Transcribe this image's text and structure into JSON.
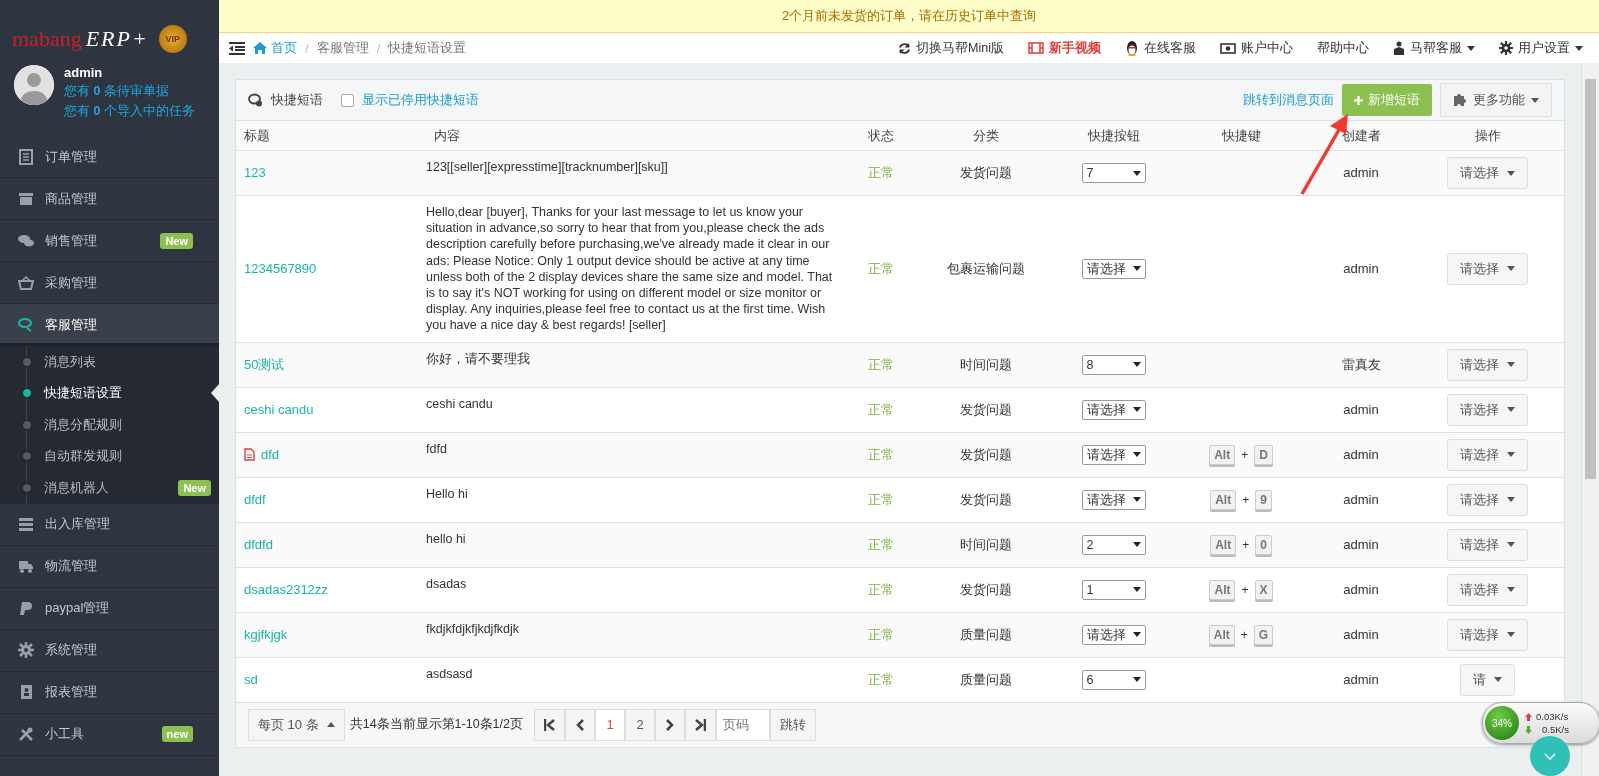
{
  "sidebar": {
    "logo": {
      "brand": "mabang",
      "product": "ERP+",
      "badge": "VIP"
    },
    "user": {
      "name": "admin",
      "lines": [
        "您有 **0** 条待审单据",
        "您有 **0** 个导入中的任务"
      ]
    },
    "menu": [
      {
        "label": "订单管理",
        "selected": false,
        "expanded": false
      },
      {
        "label": "商品管理",
        "selected": false,
        "expanded": false
      },
      {
        "label": "销售管理",
        "selected": false,
        "expanded": false,
        "badge": "New"
      },
      {
        "label": "采购管理",
        "selected": false,
        "expanded": false
      },
      {
        "label": "客服管理",
        "selected": true,
        "expanded": true,
        "children": [
          {
            "label": "消息列表",
            "selected": false
          },
          {
            "label": "快捷短语设置",
            "selected": true
          },
          {
            "label": "消息分配规则",
            "selected": false
          },
          {
            "label": "自动群发规则",
            "selected": false
          },
          {
            "label": "消息机器人",
            "selected": false,
            "badge": "New"
          }
        ]
      },
      {
        "label": "出入库管理",
        "selected": false,
        "expanded": false
      },
      {
        "label": "物流管理",
        "selected": false,
        "expanded": false
      },
      {
        "label": "paypal管理",
        "selected": false,
        "expanded": false
      },
      {
        "label": "系统管理",
        "selected": false,
        "expanded": false
      },
      {
        "label": "报表管理",
        "selected": false,
        "expanded": false
      },
      {
        "label": "小工具",
        "selected": false,
        "expanded": false,
        "badge": "new"
      }
    ]
  },
  "notice": "2个月前未发货的订单，请在历史订单中查询",
  "breadcrumb": [
    {
      "label": "首页"
    },
    {
      "separator": "/",
      "label": "客服管理"
    },
    {
      "separator": "/",
      "label": "快捷短语设置"
    }
  ],
  "nav": [
    {
      "label": "切换马帮Mini版",
      "highlighted": false,
      "dropdown": false
    },
    {
      "label": "新手视频",
      "highlighted": true,
      "dropdown": false
    },
    {
      "label": "在线客服",
      "highlighted": false,
      "dropdown": false
    },
    {
      "label": "账户中心",
      "highlighted": false,
      "dropdown": false
    },
    {
      "label": "帮助中心",
      "highlighted": false,
      "dropdown": false
    },
    {
      "label": "马帮客服",
      "highlighted": false,
      "dropdown": true
    },
    {
      "label": "用户设置",
      "highlighted": false,
      "dropdown": true
    }
  ],
  "panel": {
    "title": "快捷短语",
    "show_disabled": {
      "label": "显示已停用快捷短语",
      "checked": false
    },
    "jump_link": "跳转到消息页面",
    "add_button": "新增短语",
    "more_button": "更多功能"
  },
  "table": {
    "columns": [
      "标题",
      "内容",
      "状态",
      "分类",
      "快捷按钮",
      "快捷键",
      "创建者",
      "操作"
    ],
    "rows": [
      {
        "title": "123",
        "attachment": false,
        "content": "123[[seller][expresstime][tracknumber][sku]]",
        "status": "正常",
        "category": "发货问题",
        "quick_button": "7",
        "creator": "admin",
        "action": "请选择"
      },
      {
        "title": "1234567890",
        "attachment": false,
        "content": "Hello,dear [buyer], Thanks for your last message to let us know your situation in advance,so sorry to hear that from you,please check the ads description carefully before purchasing,we've already made it clear in our ads: Please Notice: Only 1 output device should be active at any time unless both of the 2 display devices share the same size and model. That is to say it's NOT working for using on different model or size monitor or display. Any inquiries,please feel free to contact us at the first time. Wish you have a nice day & best regards! [seller]",
        "status": "正常",
        "category": "包裹运输问题",
        "quick_button": "请选择",
        "creator": "admin",
        "action": "请选择"
      },
      {
        "title": "50测试",
        "attachment": false,
        "content": "你好，请不要理我",
        "status": "正常",
        "category": "时间问题",
        "quick_button": "8",
        "creator": "雷真友",
        "action": "请选择"
      },
      {
        "title": "ceshi candu",
        "attachment": false,
        "content": "ceshi candu",
        "status": "正常",
        "category": "发货问题",
        "quick_button": "请选择",
        "creator": "admin",
        "action": "请选择"
      },
      {
        "title": "dfd",
        "attachment": true,
        "content": "fdfd",
        "status": "正常",
        "category": "发货问题",
        "quick_button": "请选择",
        "hotkey": {
          "modifier": "Alt",
          "joiner": "+",
          "key": "D"
        },
        "creator": "admin",
        "action": "请选择"
      },
      {
        "title": "dfdf",
        "attachment": false,
        "content": "Hello hi",
        "status": "正常",
        "category": "发货问题",
        "quick_button": "请选择",
        "hotkey": {
          "modifier": "Alt",
          "joiner": "+",
          "key": "9"
        },
        "creator": "admin",
        "action": "请选择"
      },
      {
        "title": "dfdfd",
        "attachment": false,
        "content": "hello hi",
        "status": "正常",
        "category": "时间问题",
        "quick_button": "2",
        "hotkey": {
          "modifier": "Alt",
          "joiner": "+",
          "key": "0"
        },
        "creator": "admin",
        "action": "请选择"
      },
      {
        "title": "dsadas2312zz",
        "attachment": false,
        "content": "dsadas",
        "status": "正常",
        "category": "发货问题",
        "quick_button": "1",
        "hotkey": {
          "modifier": "Alt",
          "joiner": "+",
          "key": "X"
        },
        "creator": "admin",
        "action": "请选择"
      },
      {
        "title": "kgjfkjgk",
        "attachment": false,
        "content": "fkdjkfdjkfjkdjfkdjk",
        "status": "正常",
        "category": "质量问题",
        "quick_button": "请选择",
        "hotkey": {
          "modifier": "Alt",
          "joiner": "+",
          "key": "G"
        },
        "creator": "admin",
        "action": "请选择"
      },
      {
        "title": "sd",
        "attachment": false,
        "content": "asdsasd",
        "status": "正常",
        "category": "质量问题",
        "quick_button": "6",
        "creator": "admin",
        "action": "请"
      }
    ]
  },
  "pager": {
    "page_size": "每页 10 条",
    "info": "共14条当前显示第1-10条1/2页",
    "pages": [
      {
        "label": "1",
        "selected": true
      },
      {
        "label": "2",
        "selected": false
      }
    ],
    "page_input": {
      "placeholder": "页码"
    },
    "go_button": "跳转"
  },
  "net_meter": {
    "percent": "34%",
    "upload": "0.03K/s",
    "download": "0.5K/s"
  }
}
